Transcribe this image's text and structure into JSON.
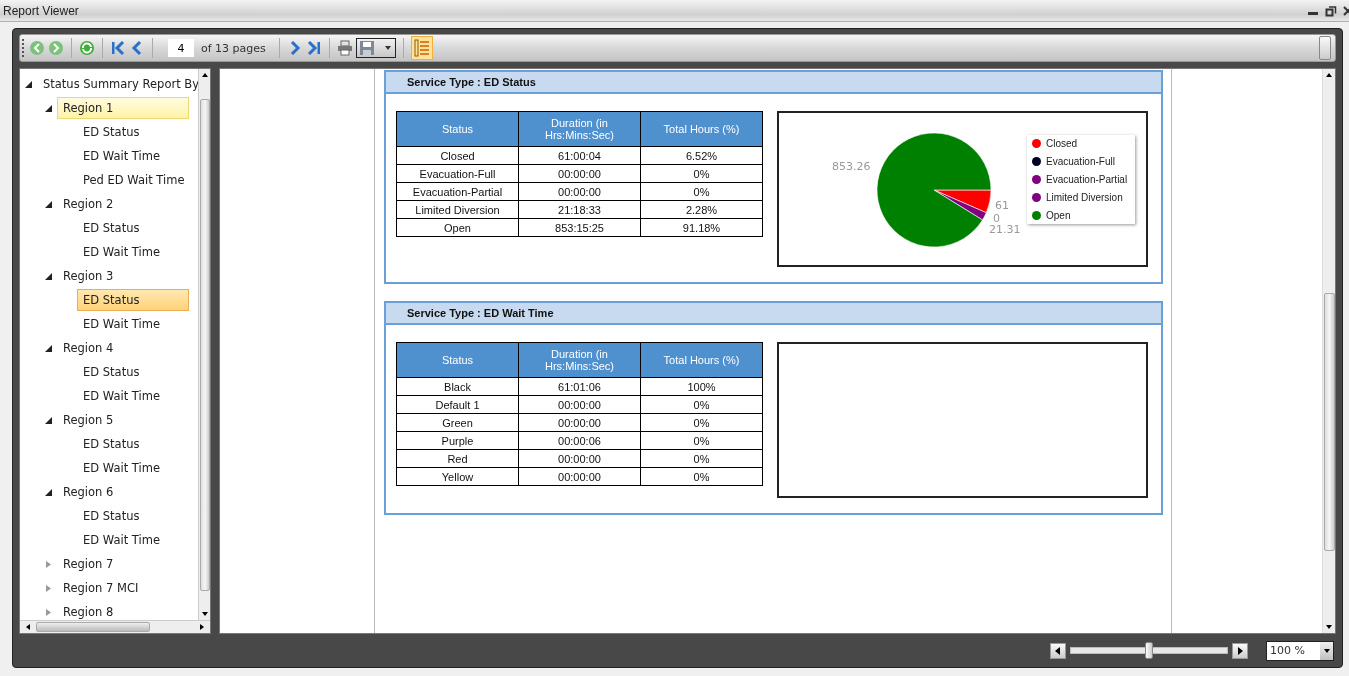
{
  "window": {
    "title": "Report Viewer"
  },
  "toolbar": {
    "page": "4",
    "page_count": "of 13 pages",
    "tree_toggle_pressed": true
  },
  "tree": {
    "label": "Status Summary Report By",
    "expanded": true,
    "selected": false,
    "hovered": false,
    "children": [
      {
        "label": "Region 1",
        "expanded": true,
        "selected": false,
        "hovered": true,
        "children": [
          {
            "label": "ED Status",
            "selected": false,
            "hovered": false
          },
          {
            "label": "ED Wait Time",
            "selected": false,
            "hovered": false
          },
          {
            "label": "Ped ED Wait Time",
            "selected": false,
            "hovered": false
          }
        ]
      },
      {
        "label": "Region 2",
        "expanded": true,
        "selected": false,
        "hovered": false,
        "children": [
          {
            "label": "ED Status",
            "selected": false,
            "hovered": false
          },
          {
            "label": "ED Wait Time",
            "selected": false,
            "hovered": false
          }
        ]
      },
      {
        "label": "Region 3",
        "expanded": true,
        "selected": false,
        "hovered": false,
        "children": [
          {
            "label": "ED Status",
            "selected": true,
            "hovered": false
          },
          {
            "label": "ED Wait Time",
            "selected": false,
            "hovered": false
          }
        ]
      },
      {
        "label": "Region 4",
        "expanded": true,
        "selected": false,
        "hovered": false,
        "children": [
          {
            "label": "ED Status",
            "selected": false,
            "hovered": false
          },
          {
            "label": "ED Wait Time",
            "selected": false,
            "hovered": false
          }
        ]
      },
      {
        "label": "Region 5",
        "expanded": true,
        "selected": false,
        "hovered": false,
        "children": [
          {
            "label": "ED Status",
            "selected": false,
            "hovered": false
          },
          {
            "label": "ED Wait Time",
            "selected": false,
            "hovered": false
          }
        ]
      },
      {
        "label": "Region 6",
        "expanded": true,
        "selected": false,
        "hovered": false,
        "children": [
          {
            "label": "ED Status",
            "selected": false,
            "hovered": false
          },
          {
            "label": "ED Wait Time",
            "selected": false,
            "hovered": false
          }
        ]
      },
      {
        "label": "Region 7",
        "expanded": false,
        "selected": false,
        "hovered": false
      },
      {
        "label": "Region 7 MCI",
        "expanded": false,
        "selected": false,
        "hovered": false
      },
      {
        "label": "Region 8",
        "expanded": false,
        "selected": false,
        "hovered": false
      }
    ]
  },
  "sections": [
    {
      "title": "Service Type : ED Status",
      "columns": [
        "Status",
        "Duration (in Hrs:Mins:Sec)",
        "Total Hours (%)"
      ],
      "rows": [
        [
          "Closed",
          "61:00:04",
          "6.52%"
        ],
        [
          "Evacuation-Full",
          "00:00:00",
          "0%"
        ],
        [
          "Evacuation-Partial",
          "00:00:00",
          "0%"
        ],
        [
          "Limited Diversion",
          "21:18:33",
          "2.28%"
        ],
        [
          "Open",
          "853:15:25",
          "91.18%"
        ]
      ],
      "slice_labels": [
        "853.26",
        "61",
        "0",
        "21.31"
      ],
      "chart_data": {
        "type": "pie",
        "categories": [
          "Closed",
          "Evacuation-Full",
          "Evacuation-Partial",
          "Limited Diversion",
          "Open"
        ],
        "values": [
          6.52,
          0,
          0,
          2.28,
          91.18
        ],
        "legend": "right",
        "colors": [
          "#ff0000",
          "#000022",
          "#800080",
          "#800080",
          "#008000"
        ]
      }
    },
    {
      "title": "Service Type : ED Wait Time",
      "columns": [
        "Status",
        "Duration (in Hrs:Mins:Sec)",
        "Total Hours (%)"
      ],
      "rows": [
        [
          "Black",
          "61:01:06",
          "100%"
        ],
        [
          "Default 1",
          "00:00:00",
          "0%"
        ],
        [
          "Green",
          "00:00:00",
          "0%"
        ],
        [
          "Purple",
          "00:00:06",
          "0%"
        ],
        [
          "Red",
          "00:00:00",
          "0%"
        ],
        [
          "Yellow",
          "00:00:00",
          "0%"
        ]
      ]
    }
  ],
  "zoom": {
    "level": 0.5,
    "value": "100 %"
  }
}
